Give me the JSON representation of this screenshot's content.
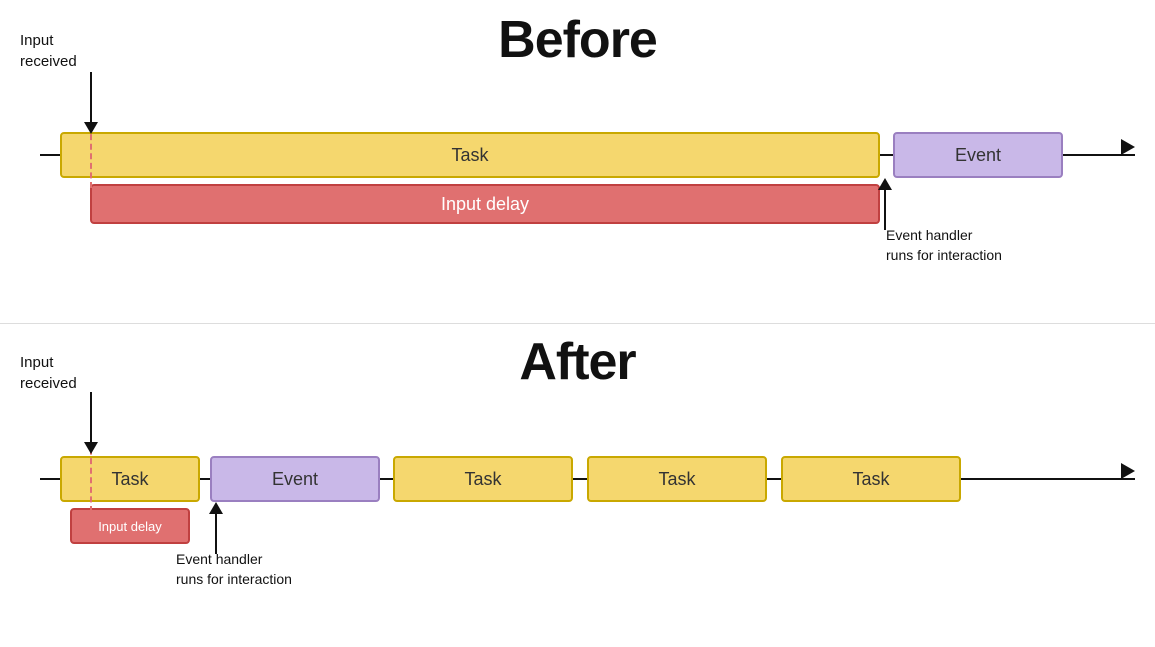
{
  "before": {
    "title": "Before",
    "input_received_label": "Input\nreceived",
    "task_label": "Task",
    "event_label": "Event",
    "input_delay_label": "Input delay",
    "event_handler_label": "Event handler\nruns for interaction"
  },
  "after": {
    "title": "After",
    "input_received_label": "Input\nreceived",
    "task_label": "Task",
    "event_label": "Event",
    "input_delay_label": "Input delay",
    "event_handler_label": "Event handler\nruns for interaction",
    "task2_label": "Task",
    "task3_label": "Task",
    "task4_label": "Task"
  }
}
